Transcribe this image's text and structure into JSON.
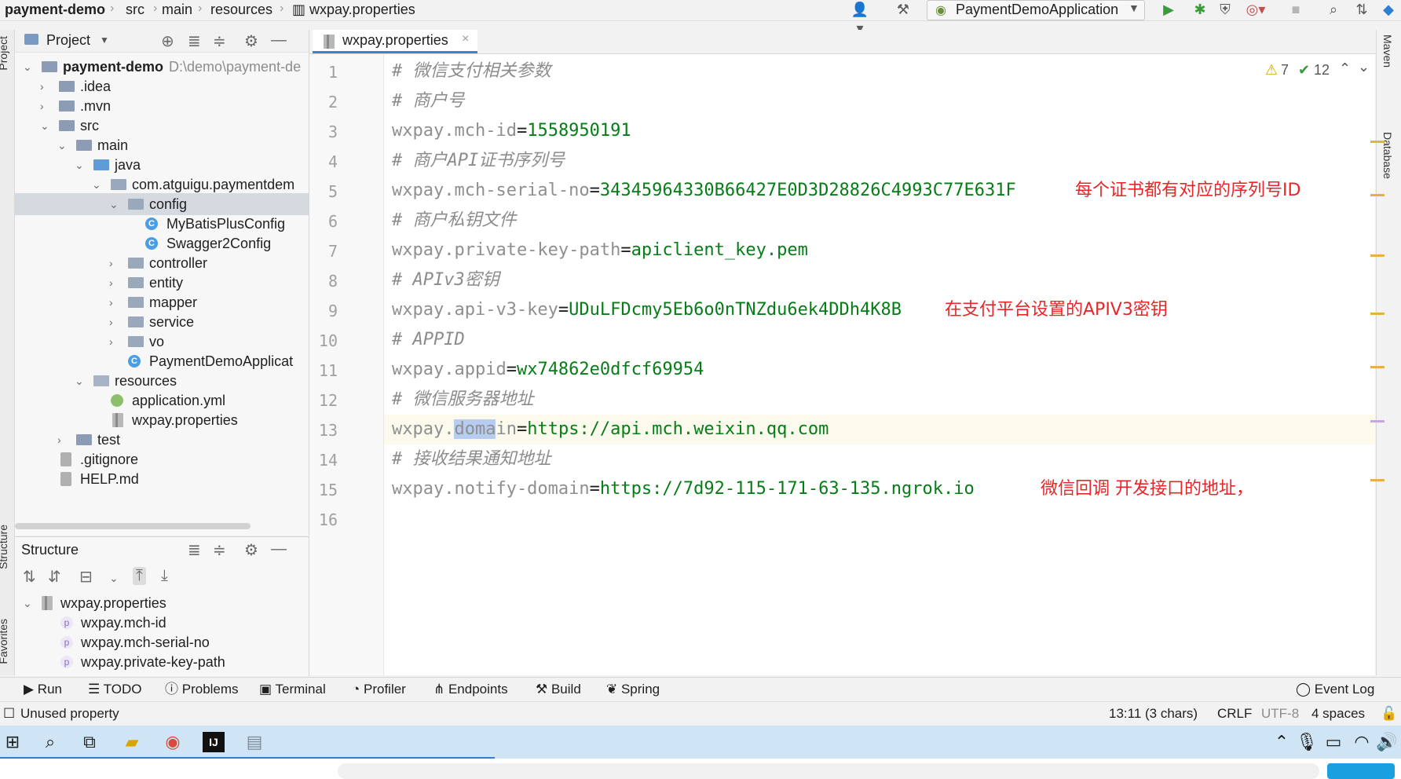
{
  "navbar": {
    "crumbs": [
      "payment-demo",
      "src",
      "main",
      "resources",
      "wxpay.properties"
    ],
    "run_config": "PaymentDemoApplication"
  },
  "left_strip": {
    "project_tab": "Project",
    "structure_tab": "Structure",
    "favorites_tab": "Favorites"
  },
  "right_strip": {
    "maven_tab": "Maven",
    "database_tab": "Database"
  },
  "project": {
    "title": "Project",
    "root_name": "payment-demo",
    "root_path": "D:\\demo\\payment-de",
    "items": [
      {
        "label": "payment-demo"
      },
      {
        "label": ".idea"
      },
      {
        "label": ".mvn"
      },
      {
        "label": "src"
      },
      {
        "label": "main"
      },
      {
        "label": "java"
      },
      {
        "label": "com.atguigu.paymentdem"
      },
      {
        "label": "config"
      },
      {
        "label": "MyBatisPlusConfig"
      },
      {
        "label": "Swagger2Config"
      },
      {
        "label": "controller"
      },
      {
        "label": "entity"
      },
      {
        "label": "mapper"
      },
      {
        "label": "service"
      },
      {
        "label": "vo"
      },
      {
        "label": "PaymentDemoApplicat"
      },
      {
        "label": "resources"
      },
      {
        "label": "application.yml"
      },
      {
        "label": "wxpay.properties"
      },
      {
        "label": "test"
      },
      {
        "label": ".gitignore"
      },
      {
        "label": "HELP.md"
      }
    ]
  },
  "structure": {
    "title": "Structure",
    "root": "wxpay.properties",
    "items": [
      "wxpay.mch-id",
      "wxpay.mch-serial-no",
      "wxpay.private-key-path"
    ]
  },
  "editor": {
    "tab_label": "wxpay.properties",
    "warnings": "7",
    "weak_warnings": "12",
    "lines": [
      {
        "n": "1",
        "comment": "# 微信支付相关参数"
      },
      {
        "n": "2",
        "comment": "# 商户号"
      },
      {
        "n": "3",
        "key": "wxpay.mch-id",
        "value": "1558950191"
      },
      {
        "n": "4",
        "comment": "# 商户API证书序列号"
      },
      {
        "n": "5",
        "key": "wxpay.mch-serial-no",
        "value": "34345964330B66427E0D3D28826C4993C77E631F"
      },
      {
        "n": "6",
        "comment": "# 商户私钥文件"
      },
      {
        "n": "7",
        "key": "wxpay.private-key-path",
        "value": "apiclient_key.pem"
      },
      {
        "n": "8",
        "comment": "# APIv3密钥"
      },
      {
        "n": "9",
        "key": "wxpay.api-v3-key",
        "value": "UDuLFDcmy5Eb6o0nTNZdu6ek4DDh4K8B"
      },
      {
        "n": "10",
        "comment": "# APPID"
      },
      {
        "n": "11",
        "key": "wxpay.appid",
        "value": "wx74862e0dfcf69954"
      },
      {
        "n": "12",
        "comment": "# 微信服务器地址"
      },
      {
        "n": "13",
        "key_pre": "wxpay.",
        "key_sel": "doma",
        "key_post": "in",
        "value": "https://api.mch.weixin.qq.com"
      },
      {
        "n": "14",
        "comment": "# 接收结果通知地址"
      },
      {
        "n": "15",
        "key": "wxpay.notify-domain",
        "value": "https://7d92-115-171-63-135.ngrok.io"
      },
      {
        "n": "16"
      }
    ],
    "annotations": {
      "serial": "每个证书都有对应的序列号ID",
      "apikey": "在支付平台设置的APIV3密钥",
      "notify": "微信回调 开发接口的地址，"
    }
  },
  "tool_tabs": [
    "Run",
    "TODO",
    "Problems",
    "Terminal",
    "Profiler",
    "Endpoints",
    "Build",
    "Spring",
    "Event Log"
  ],
  "status": {
    "message": "Unused property",
    "position": "13:11 (3 chars)",
    "line_sep": "CRLF",
    "encoding": "UTF-8",
    "indent": "4 spaces"
  },
  "colors": {
    "accent": "#4083c9",
    "annotation": "#e8262a",
    "value": "#067d17",
    "taskbar": "#cfe5f5"
  }
}
